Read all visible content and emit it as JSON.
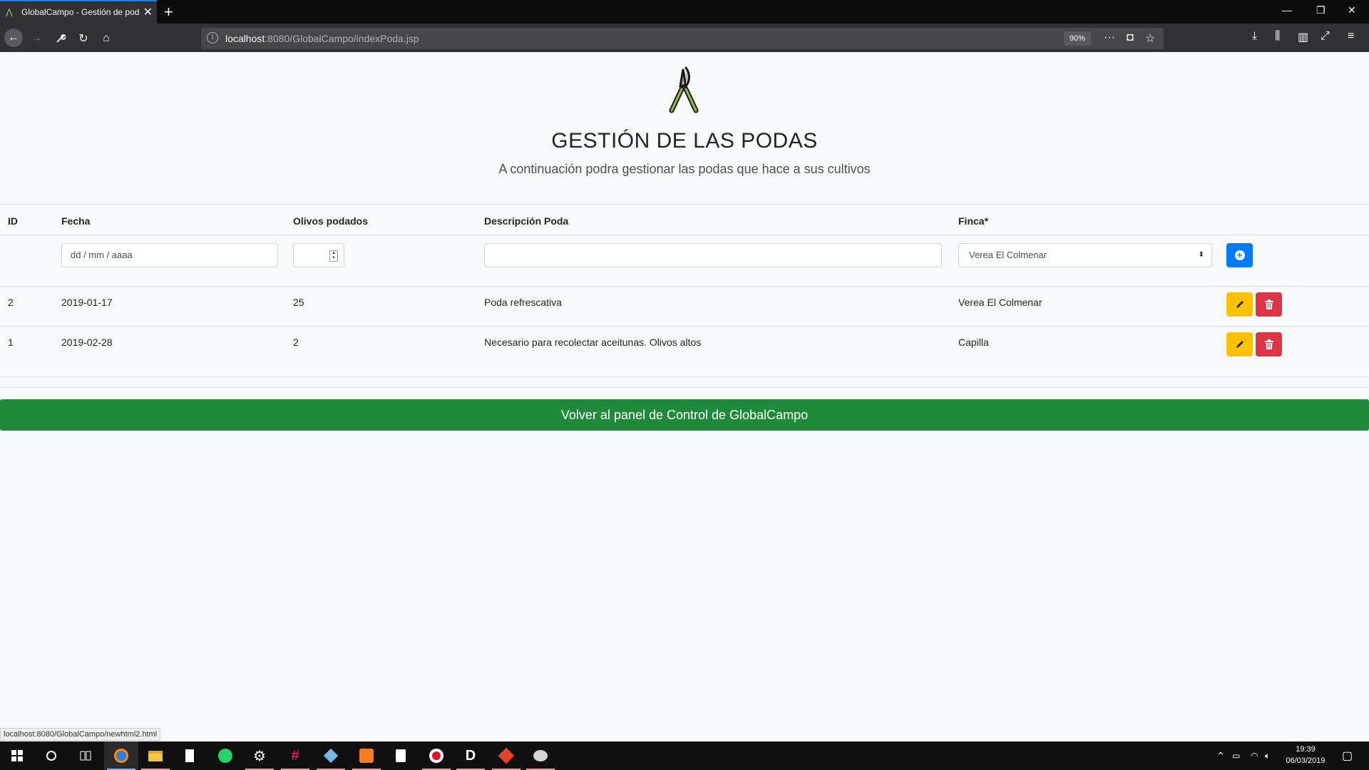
{
  "browser": {
    "tab_title": "GlobalCampo - Gestión de pod",
    "url_host": "localhost",
    "url_path": ":8080/GlobalCampo/indexPoda.jsp",
    "zoom": "90%",
    "status_url": "localhost:8080/GlobalCampo/newhtml2.html"
  },
  "header": {
    "title": "GESTIÓN DE LAS PODAS",
    "subtitle": "A continuación podra gestionar las podas que hace a sus cultivos",
    "logo_icon": "pruning-shears-icon"
  },
  "table": {
    "columns": [
      "ID",
      "Fecha",
      "Olivos podados",
      "Descripción Poda",
      "Finca*"
    ],
    "new_row": {
      "date_placeholder": "dd / mm / aaaa",
      "olives_value": "",
      "description_value": "",
      "finca_selected": "Verea El Colmenar"
    },
    "rows": [
      {
        "id": "2",
        "fecha": "2019-01-17",
        "olivos": "25",
        "descripcion": "Poda refrescativa",
        "finca": "Verea El Colmenar"
      },
      {
        "id": "1",
        "fecha": "2019-02-28",
        "olivos": "2",
        "descripcion": "Necesario para recolectar aceitunas. Olivos altos",
        "finca": "Capilla"
      }
    ]
  },
  "actions": {
    "back_label": "Volver al panel de Control de GlobalCampo"
  },
  "colors": {
    "primary": "#007bff",
    "warning": "#ffc107",
    "danger": "#dc3545",
    "success": "#1f8b3a"
  },
  "taskbar": {
    "time": "19:39",
    "date": "06/03/2019"
  }
}
